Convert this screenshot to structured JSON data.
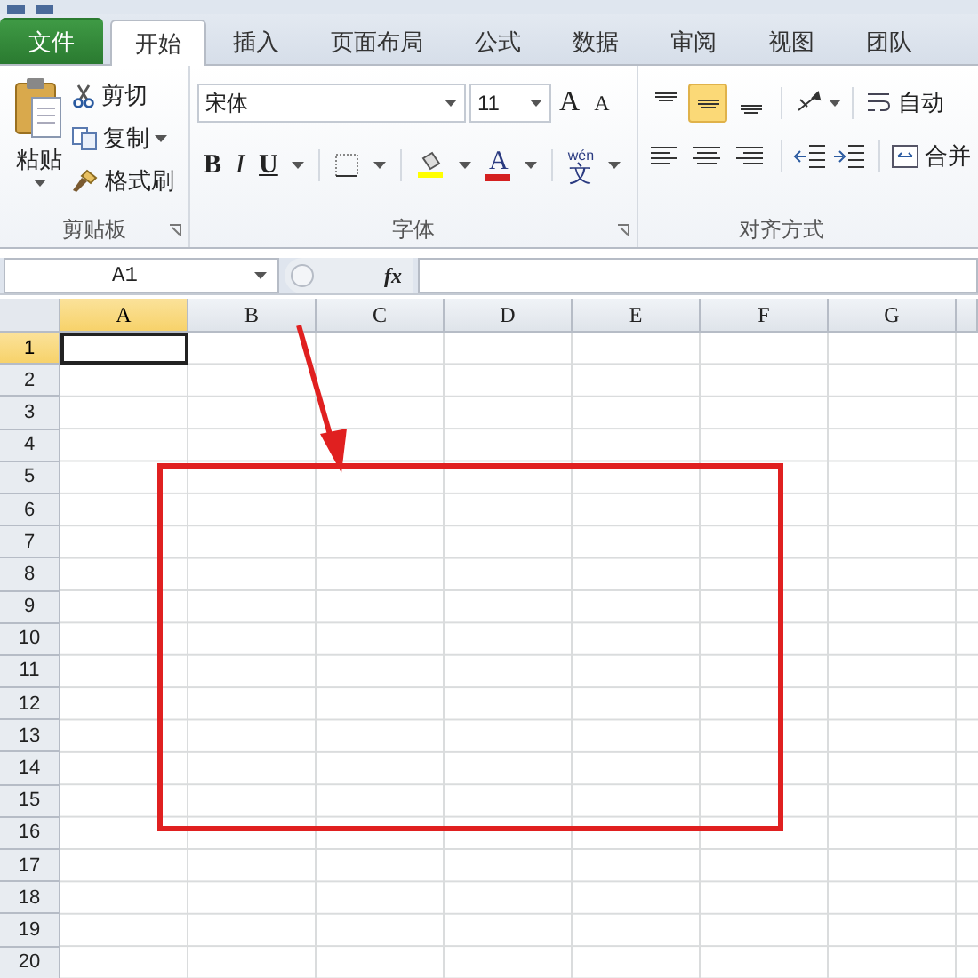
{
  "tabs": [
    {
      "label": "文件",
      "kind": "file",
      "selected": false
    },
    {
      "label": "开始",
      "kind": "normal",
      "selected": true
    },
    {
      "label": "插入",
      "kind": "normal",
      "selected": false
    },
    {
      "label": "页面布局",
      "kind": "normal",
      "selected": false
    },
    {
      "label": "公式",
      "kind": "normal",
      "selected": false
    },
    {
      "label": "数据",
      "kind": "normal",
      "selected": false
    },
    {
      "label": "审阅",
      "kind": "normal",
      "selected": false
    },
    {
      "label": "视图",
      "kind": "normal",
      "selected": false
    },
    {
      "label": "团队",
      "kind": "normal",
      "selected": false
    }
  ],
  "clipboard": {
    "paste": "粘贴",
    "items": [
      {
        "label": "剪切",
        "kind": "cut"
      },
      {
        "label": "复制",
        "kind": "copy"
      },
      {
        "label": "格式刷",
        "kind": "painter"
      }
    ],
    "group_label": "剪贴板"
  },
  "font": {
    "font_name": "宋体",
    "font_size": "11",
    "size_buttons": [
      {
        "label": "A",
        "kind": "grow"
      },
      {
        "label": "A",
        "kind": "shrink"
      }
    ],
    "bold": "B",
    "italic": "I",
    "underline": "U",
    "font_color": "A",
    "phonetic": {
      "pinyin": "wén",
      "char": "文"
    },
    "group_label": "字体"
  },
  "alignment": {
    "vertical": [
      {
        "kind": "top",
        "selected": false
      },
      {
        "kind": "middle",
        "selected": true
      },
      {
        "kind": "bottom",
        "selected": false
      }
    ],
    "wrap": "自动",
    "merge": "合并",
    "group_label": "对齐方式"
  },
  "formula_bar": {
    "name_box": "A1",
    "fx": "fx"
  },
  "sheet": {
    "columns": [
      {
        "label": "A",
        "selected": true
      },
      {
        "label": "B",
        "selected": false
      },
      {
        "label": "C",
        "selected": false
      },
      {
        "label": "D",
        "selected": false
      },
      {
        "label": "E",
        "selected": false
      },
      {
        "label": "F",
        "selected": false
      },
      {
        "label": "G",
        "selected": false
      }
    ],
    "rows": [
      {
        "label": "1",
        "selected": true
      },
      {
        "label": "2",
        "selected": false
      },
      {
        "label": "3",
        "selected": false
      },
      {
        "label": "4",
        "selected": false
      },
      {
        "label": "5",
        "selected": false
      },
      {
        "label": "6",
        "selected": false
      },
      {
        "label": "7",
        "selected": false
      },
      {
        "label": "8",
        "selected": false
      },
      {
        "label": "9",
        "selected": false
      },
      {
        "label": "10",
        "selected": false
      },
      {
        "label": "11",
        "selected": false
      },
      {
        "label": "12",
        "selected": false
      },
      {
        "label": "13",
        "selected": false
      },
      {
        "label": "14",
        "selected": false
      },
      {
        "label": "15",
        "selected": false
      },
      {
        "label": "16",
        "selected": false
      },
      {
        "label": "17",
        "selected": false
      },
      {
        "label": "18",
        "selected": false
      },
      {
        "label": "19",
        "selected": false
      },
      {
        "label": "20",
        "selected": false
      }
    ]
  },
  "annotations": {
    "arrow": {
      "color": "#e02020"
    },
    "highlight_box": {
      "color": "#e02020"
    }
  }
}
